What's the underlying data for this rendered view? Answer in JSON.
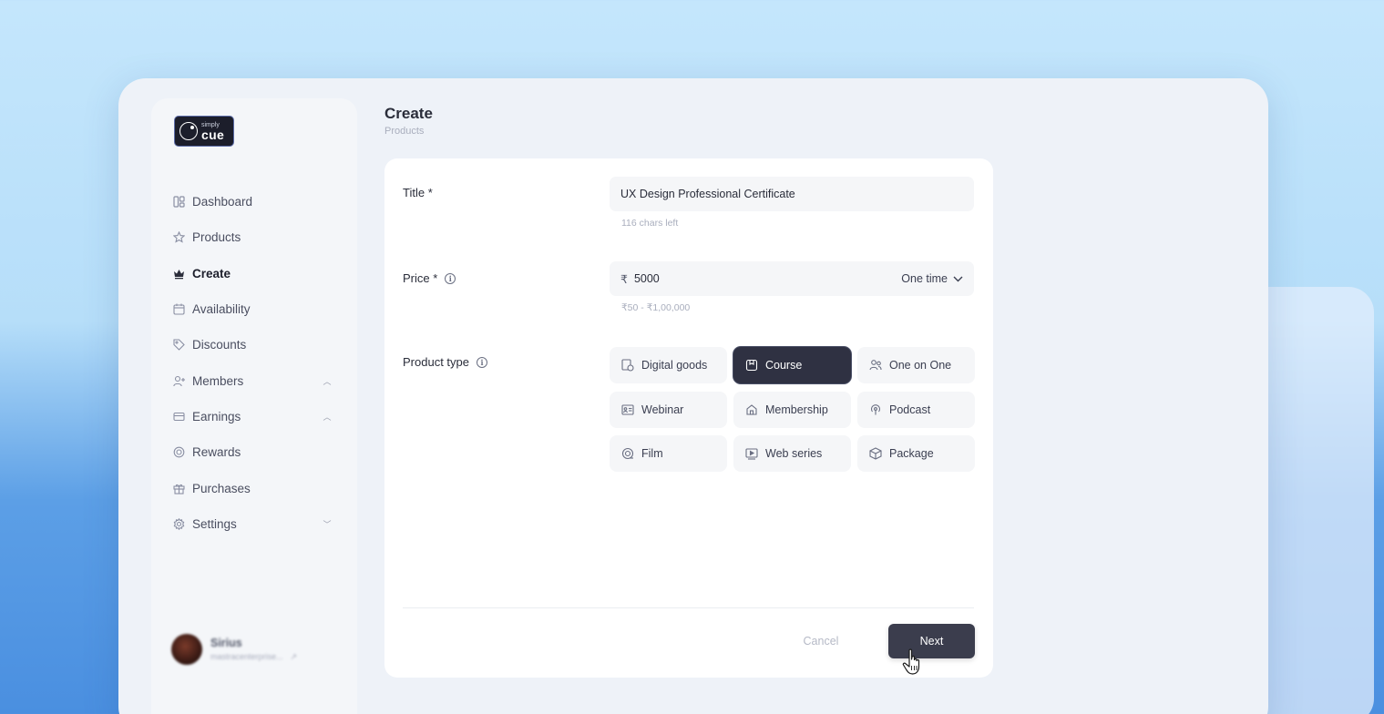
{
  "brand": {
    "small": "simply",
    "name": "cue"
  },
  "sidebar": {
    "items": [
      {
        "label": "Dashboard",
        "icon": "dashboard-icon",
        "active": false,
        "chevron": ""
      },
      {
        "label": "Products",
        "icon": "star-icon",
        "active": false,
        "chevron": ""
      },
      {
        "label": "Create",
        "icon": "crown-icon",
        "active": true,
        "chevron": ""
      },
      {
        "label": "Availability",
        "icon": "calendar-icon",
        "active": false,
        "chevron": ""
      },
      {
        "label": "Discounts",
        "icon": "tag-icon",
        "active": false,
        "chevron": ""
      },
      {
        "label": "Members",
        "icon": "user-add-icon",
        "active": false,
        "chevron": "up"
      },
      {
        "label": "Earnings",
        "icon": "card-icon",
        "active": false,
        "chevron": "up"
      },
      {
        "label": "Rewards",
        "icon": "reward-icon",
        "active": false,
        "chevron": ""
      },
      {
        "label": "Purchases",
        "icon": "gift-icon",
        "active": false,
        "chevron": ""
      },
      {
        "label": "Settings",
        "icon": "gear-icon",
        "active": false,
        "chevron": "down"
      }
    ],
    "user": {
      "name": "Sirius",
      "email": "mastracenterprise..."
    }
  },
  "header": {
    "title": "Create",
    "breadcrumb": "Products"
  },
  "form": {
    "title": {
      "label": "Title *",
      "value": "UX Design Professional Certificate",
      "hint": "116 chars left"
    },
    "price": {
      "label": "Price *",
      "currency": "₹",
      "value": "5000",
      "frequency": "One time",
      "hint": "₹50 - ₹1,00,000"
    },
    "product_type": {
      "label": "Product type",
      "selected": "Course",
      "options": [
        {
          "label": "Digital goods",
          "icon": "digital-goods-icon"
        },
        {
          "label": "Course",
          "icon": "course-icon"
        },
        {
          "label": "One on One",
          "icon": "one-on-one-icon"
        },
        {
          "label": "Webinar",
          "icon": "webinar-icon"
        },
        {
          "label": "Membership",
          "icon": "membership-icon"
        },
        {
          "label": "Podcast",
          "icon": "podcast-icon"
        },
        {
          "label": "Film",
          "icon": "film-icon"
        },
        {
          "label": "Web series",
          "icon": "web-series-icon"
        },
        {
          "label": "Package",
          "icon": "package-icon"
        }
      ]
    }
  },
  "actions": {
    "cancel": "Cancel",
    "next": "Next"
  }
}
